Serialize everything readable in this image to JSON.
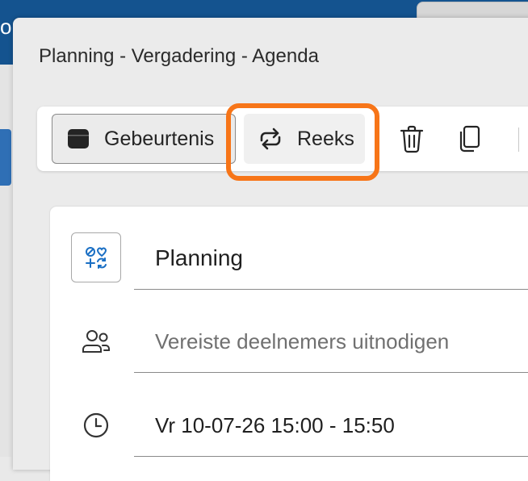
{
  "background": {
    "topbar_fragment": "o"
  },
  "dialog": {
    "title": "Planning - Vergadering - Agenda"
  },
  "toolbar": {
    "event_label": "Gebeurtenis",
    "series_label": "Reeks",
    "icons": {
      "event": "calendar-event-icon",
      "series": "repeat-icon",
      "delete": "trash-icon",
      "copy": "copy-icon"
    }
  },
  "form": {
    "title_value": "Planning",
    "attendees_placeholder": "Vereiste deelnemers uitnodigen",
    "datetime_value": "Vr 10-07-26 15:00 - 15:50",
    "icons": {
      "category": "category-icon",
      "attendees": "people-icon",
      "time": "clock-icon"
    }
  },
  "colors": {
    "highlight": "#f77518",
    "topbar": "#14538f",
    "accent_icon": "#1a6fc4"
  }
}
